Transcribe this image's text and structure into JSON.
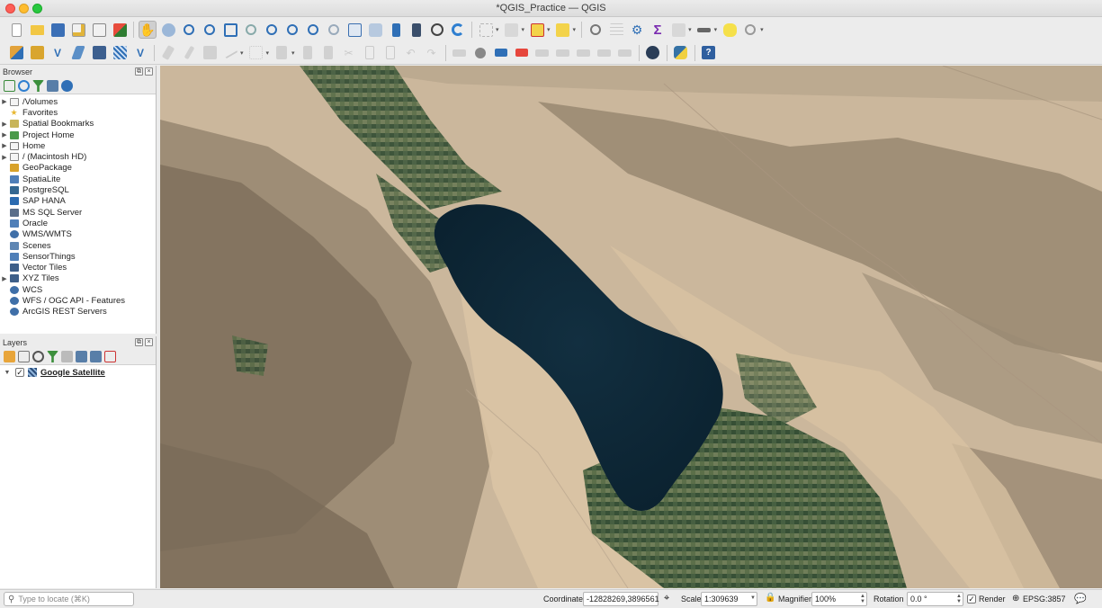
{
  "window": {
    "title": "*QGIS_Practice — QGIS"
  },
  "browser": {
    "title": "Browser",
    "items": [
      {
        "label": "/Volumes",
        "icon": "folder-icon",
        "expandable": true
      },
      {
        "label": "Favorites",
        "icon": "star-icon",
        "expandable": false
      },
      {
        "label": "Spatial Bookmarks",
        "icon": "bookmarks-icon",
        "expandable": true
      },
      {
        "label": "Project Home",
        "icon": "project-home-icon",
        "expandable": true
      },
      {
        "label": "Home",
        "icon": "home-icon",
        "expandable": true
      },
      {
        "label": "/ (Macintosh HD)",
        "icon": "folder-icon",
        "expandable": true
      },
      {
        "label": "GeoPackage",
        "icon": "geopackage-icon",
        "expandable": false
      },
      {
        "label": "SpatiaLite",
        "icon": "spatialite-icon",
        "expandable": false
      },
      {
        "label": "PostgreSQL",
        "icon": "postgresql-icon",
        "expandable": false
      },
      {
        "label": "SAP HANA",
        "icon": "sap-hana-icon",
        "expandable": false
      },
      {
        "label": "MS SQL Server",
        "icon": "mssql-icon",
        "expandable": false
      },
      {
        "label": "Oracle",
        "icon": "oracle-icon",
        "expandable": false
      },
      {
        "label": "WMS/WMTS",
        "icon": "globe-icon",
        "expandable": false
      },
      {
        "label": "Scenes",
        "icon": "scenes-icon",
        "expandable": false
      },
      {
        "label": "SensorThings",
        "icon": "sensor-icon",
        "expandable": false
      },
      {
        "label": "Vector Tiles",
        "icon": "grid-icon",
        "expandable": false
      },
      {
        "label": "XYZ Tiles",
        "icon": "grid-icon",
        "expandable": true
      },
      {
        "label": "WCS",
        "icon": "globe-icon",
        "expandable": false
      },
      {
        "label": "WFS / OGC API - Features",
        "icon": "globe-icon",
        "expandable": false
      },
      {
        "label": "ArcGIS REST Servers",
        "icon": "globe-icon",
        "expandable": false
      }
    ]
  },
  "layers": {
    "title": "Layers",
    "items": [
      {
        "label": "Google Satellite",
        "checked": true,
        "check_glyph": "✓",
        "icon": "raster-tile-icon"
      }
    ]
  },
  "statusbar": {
    "locate_placeholder": "Type to locate (⌘K)",
    "coordinate_label": "Coordinate",
    "coordinate_value": "-12828269,3896561",
    "scale_label": "Scale",
    "scale_value": "1:309639",
    "magnifier_label": "Magnifier",
    "magnifier_value": "100%",
    "rotation_label": "Rotation",
    "rotation_value": "0.0 °",
    "render_label": "Render",
    "render_checked": true,
    "crs_value": "EPSG:3857"
  },
  "colors": {
    "desert": "#cbb79c",
    "water": "#0f2a3a",
    "agriculture": "#3f5a3c",
    "mountains": "#7d6e5e"
  }
}
